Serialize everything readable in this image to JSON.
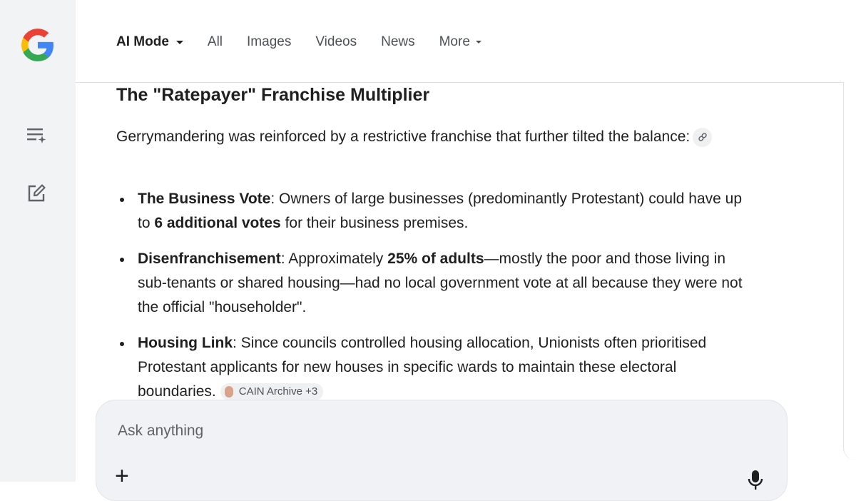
{
  "tabs": [
    {
      "label": "AI Mode",
      "active": true
    },
    {
      "label": "All"
    },
    {
      "label": "Images"
    },
    {
      "label": "Videos"
    },
    {
      "label": "News"
    },
    {
      "label": "More"
    }
  ],
  "sidebar": {
    "logo_icon": "google-g-logo",
    "items": [
      {
        "icon": "new-thread-sparkle-icon"
      },
      {
        "icon": "edit-icon"
      }
    ]
  },
  "article": {
    "heading": "The \"Ratepayer\" Franchise Multiplier",
    "intro": "Gerrymandering was reinforced by a restrictive franchise that further tilted the balance:",
    "points": [
      {
        "term": "The Business Vote",
        "text_a": ": Owners of large businesses (predominantly Protestant) could have up to ",
        "bold": "6 additional votes",
        "text_b": " for their business premises."
      },
      {
        "term": "Disenfranchisement",
        "text_a": ": Approximately ",
        "bold": "25% of adults",
        "text_b": "—mostly the poor and those living in sub-tenants or shared housing—had no local government vote at all because they were not the official \"householder\"."
      },
      {
        "term": "Housing Link",
        "text_a": ": Since councils controlled housing allocation, Unionists often prioritised Protestant applicants for new houses in specific wards to maintain these electoral boundaries.",
        "source": "CAIN Archive +3"
      }
    ]
  },
  "ask": {
    "placeholder": "Ask anything"
  },
  "colors": {
    "sidebar_bg": "#f1f3f4",
    "ask_bg": "#f0f2f5",
    "text": "#1f1f1f",
    "muted": "#4d5156"
  }
}
